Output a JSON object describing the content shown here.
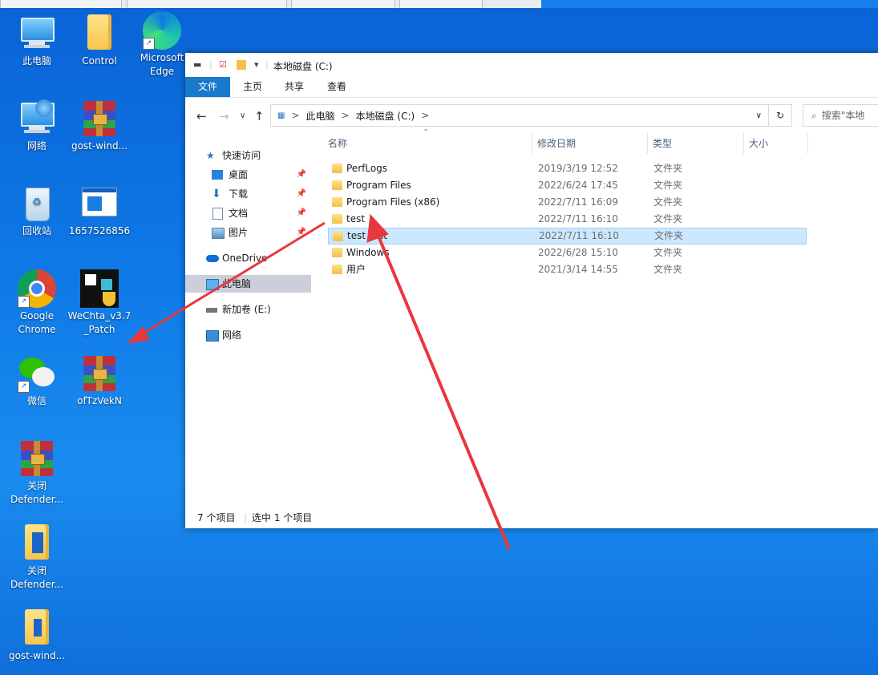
{
  "desktop": {
    "icons": [
      {
        "label": "此电脑"
      },
      {
        "label": "Control"
      },
      {
        "label": "Microsoft Edge"
      },
      {
        "label": "网络"
      },
      {
        "label": "gost-wind..."
      },
      {
        "label": "回收站"
      },
      {
        "label": "1657526856"
      },
      {
        "label": "Google Chrome"
      },
      {
        "label": "WeChta_v3.7 _Patch"
      },
      {
        "label": "微信"
      },
      {
        "label": "ofTzVekN"
      },
      {
        "label": "关闭 Defender..."
      },
      {
        "label": "关闭 Defender..."
      },
      {
        "label": "gost-wind..."
      }
    ]
  },
  "explorer": {
    "title": "本地磁盘 (C:)",
    "ribbon_tabs": [
      "文件",
      "主页",
      "共享",
      "查看"
    ],
    "address": {
      "segments": [
        "此电脑",
        "本地磁盘 (C:)"
      ],
      "separator": ">"
    },
    "search_placeholder": "搜索\"本地",
    "nav": {
      "quick_access": "快速访问",
      "items": [
        "桌面",
        "下载",
        "文档",
        "图片"
      ],
      "onedrive": "OneDrive",
      "this_pc": "此电脑",
      "drive_e": "新加卷 (E:)",
      "network": "网络"
    },
    "columns": {
      "name": "名称",
      "date": "修改日期",
      "type": "类型",
      "size": "大小"
    },
    "rows": [
      {
        "name": "PerfLogs",
        "date": "2019/3/19 12:52",
        "type": "文件夹"
      },
      {
        "name": "Program Files",
        "date": "2022/6/24 17:45",
        "type": "文件夹"
      },
      {
        "name": "Program Files (x86)",
        "date": "2022/7/11 16:09",
        "type": "文件夹"
      },
      {
        "name": "test",
        "date": "2022/7/11 16:10",
        "type": "文件夹"
      },
      {
        "name": "test test",
        "date": "2022/7/11 16:10",
        "type": "文件夹"
      },
      {
        "name": "Windows",
        "date": "2022/6/28 15:10",
        "type": "文件夹"
      },
      {
        "name": "用户",
        "date": "2021/3/14 14:55",
        "type": "文件夹"
      }
    ],
    "selected_row": 4,
    "status": {
      "count": "7 个项目",
      "selected": "选中 1 个项目"
    }
  },
  "colors": {
    "accent": "#1979ca",
    "selection": "#cce8ff",
    "arrow": "#e8383d"
  }
}
